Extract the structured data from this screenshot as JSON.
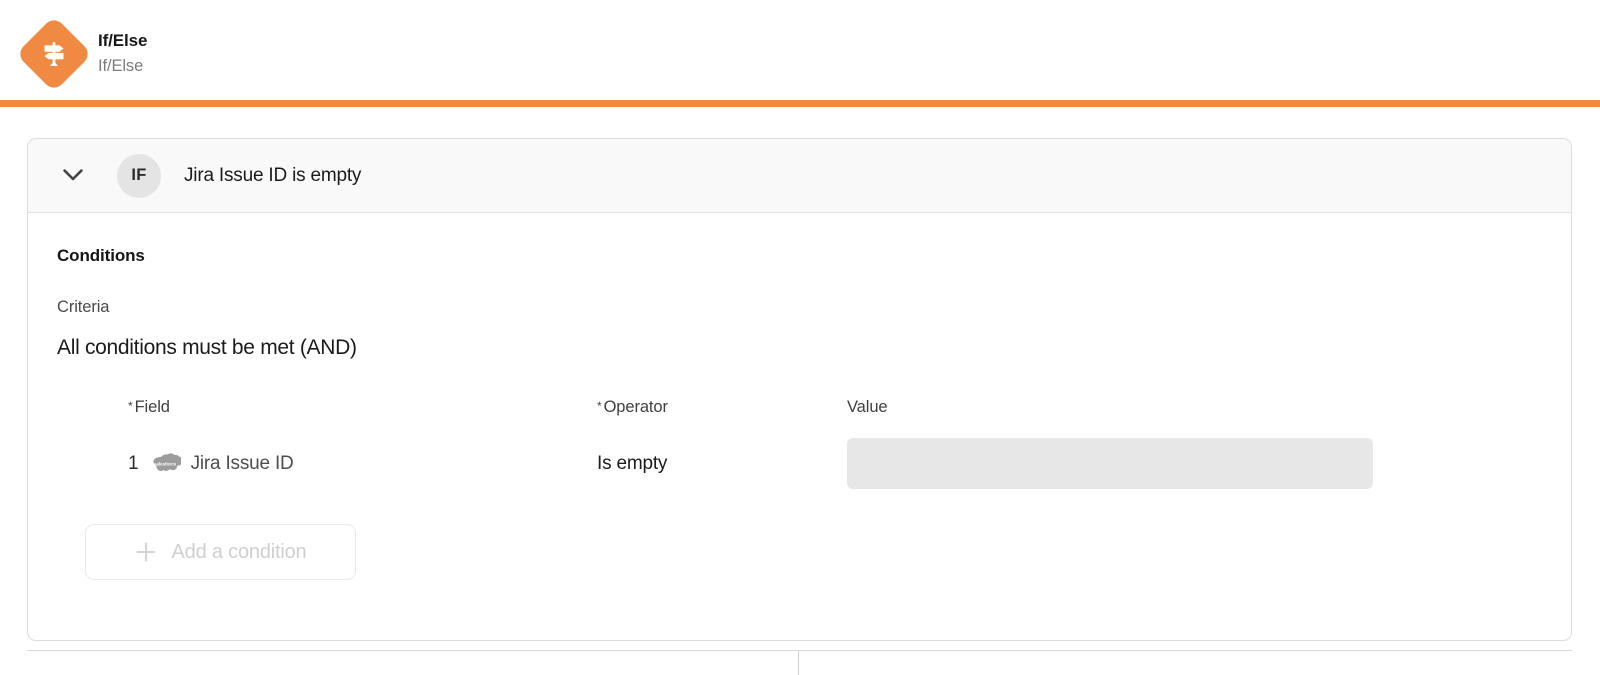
{
  "header": {
    "icon": "if-else-signpost-icon",
    "title": "If/Else",
    "subtitle": "If/Else",
    "accent_color": "#F08A42"
  },
  "card": {
    "collapse_icon": "chevron-down-icon",
    "badge_label": "IF",
    "summary": "Jira Issue ID is empty"
  },
  "conditions": {
    "heading": "Conditions",
    "criteria_label": "Criteria",
    "criteria_value": "All conditions must be met (AND)",
    "columns": {
      "field": "Field",
      "operator": "Operator",
      "value": "Value",
      "required_marker": "*"
    },
    "rows": [
      {
        "index": "1",
        "source_icon": "salesforce-cloud-icon",
        "field": "Jira Issue ID",
        "operator": "Is empty",
        "value": "",
        "value_placeholder": ""
      }
    ],
    "add_button": {
      "icon": "plus-icon",
      "label": "Add a condition"
    }
  }
}
